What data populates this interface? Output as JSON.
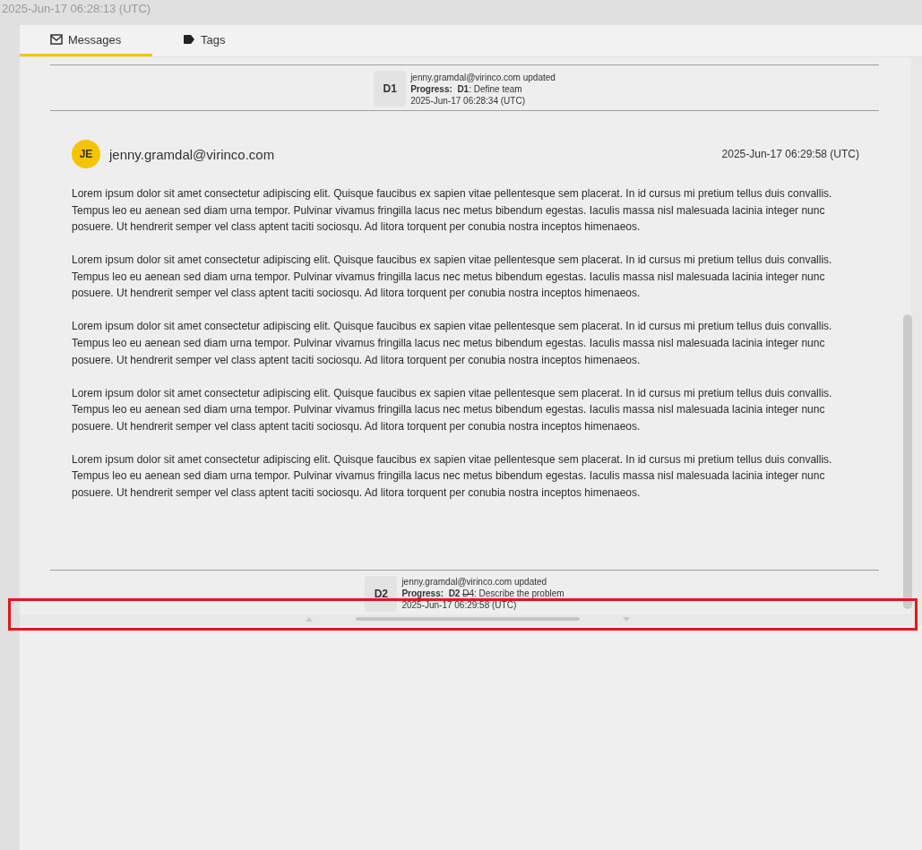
{
  "header": {
    "timestamp": "2025-Jun-17 06:28:13 (UTC)"
  },
  "tabs": [
    {
      "label": "Messages",
      "kind": "envelope",
      "selected": true
    },
    {
      "label": "Tags",
      "kind": "tag",
      "selected": false
    }
  ],
  "feed": [
    {
      "kind": "event",
      "badge": "D1",
      "author_line": "jenny.gramdal@virinco.com updated",
      "field": "Progress:",
      "new_value": "D1",
      "description": ": Define team",
      "timestamp": "2025-Jun-17 06:28:34 (UTC)"
    },
    {
      "kind": "message",
      "initials": "JE",
      "author": "jenny.gramdal@virinco.com",
      "timestamp": "2025-Jun-17 06:29:58 (UTC)",
      "paragraphs": [
        "Lorem ipsum dolor sit amet consectetur adipiscing elit. Quisque faucibus ex sapien vitae pellentesque sem placerat. In id cursus mi pretium tellus duis convallis. Tempus leo eu aenean sed diam urna tempor. Pulvinar vivamus fringilla lacus nec metus bibendum egestas. Iaculis massa nisl malesuada lacinia integer nunc posuere. Ut hendrerit semper vel class aptent taciti sociosqu. Ad litora torquent per conubia nostra inceptos himenaeos.",
        "Lorem ipsum dolor sit amet consectetur adipiscing elit. Quisque faucibus ex sapien vitae pellentesque sem placerat. In id cursus mi pretium tellus duis convallis. Tempus leo eu aenean sed diam urna tempor. Pulvinar vivamus fringilla lacus nec metus bibendum egestas. Iaculis massa nisl malesuada lacinia integer nunc posuere. Ut hendrerit semper vel class aptent taciti sociosqu. Ad litora torquent per conubia nostra inceptos himenaeos.",
        "Lorem ipsum dolor sit amet consectetur adipiscing elit. Quisque faucibus ex sapien vitae pellentesque sem placerat. In id cursus mi pretium tellus duis convallis. Tempus leo eu aenean sed diam urna tempor. Pulvinar vivamus fringilla lacus nec metus bibendum egestas. Iaculis massa nisl malesuada lacinia integer nunc posuere. Ut hendrerit semper vel class aptent taciti sociosqu. Ad litora torquent per conubia nostra inceptos himenaeos.",
        "Lorem ipsum dolor sit amet consectetur adipiscing elit. Quisque faucibus ex sapien vitae pellentesque sem placerat. In id cursus mi pretium tellus duis convallis. Tempus leo eu aenean sed diam urna tempor. Pulvinar vivamus fringilla lacus nec metus bibendum egestas. Iaculis massa nisl malesuada lacinia integer nunc posuere. Ut hendrerit semper vel class aptent taciti sociosqu. Ad litora torquent per conubia nostra inceptos himenaeos.",
        "Lorem ipsum dolor sit amet consectetur adipiscing elit. Quisque faucibus ex sapien vitae pellentesque sem placerat. In id cursus mi pretium tellus duis convallis. Tempus leo eu aenean sed diam urna tempor. Pulvinar vivamus fringilla lacus nec metus bibendum egestas. Iaculis massa nisl malesuada lacinia integer nunc posuere. Ut hendrerit semper vel class aptent taciti sociosqu. Ad litora torquent per conubia nostra inceptos himenaeos."
      ]
    },
    {
      "kind": "event",
      "badge": "D2",
      "author_line": "jenny.gramdal@virinco.com updated",
      "field": "Progress:",
      "new_value": "D2",
      "old_value": "D4",
      "description": ": Describe the problem",
      "timestamp": "2025-Jun-17 06:29:58 (UTC)"
    }
  ]
}
